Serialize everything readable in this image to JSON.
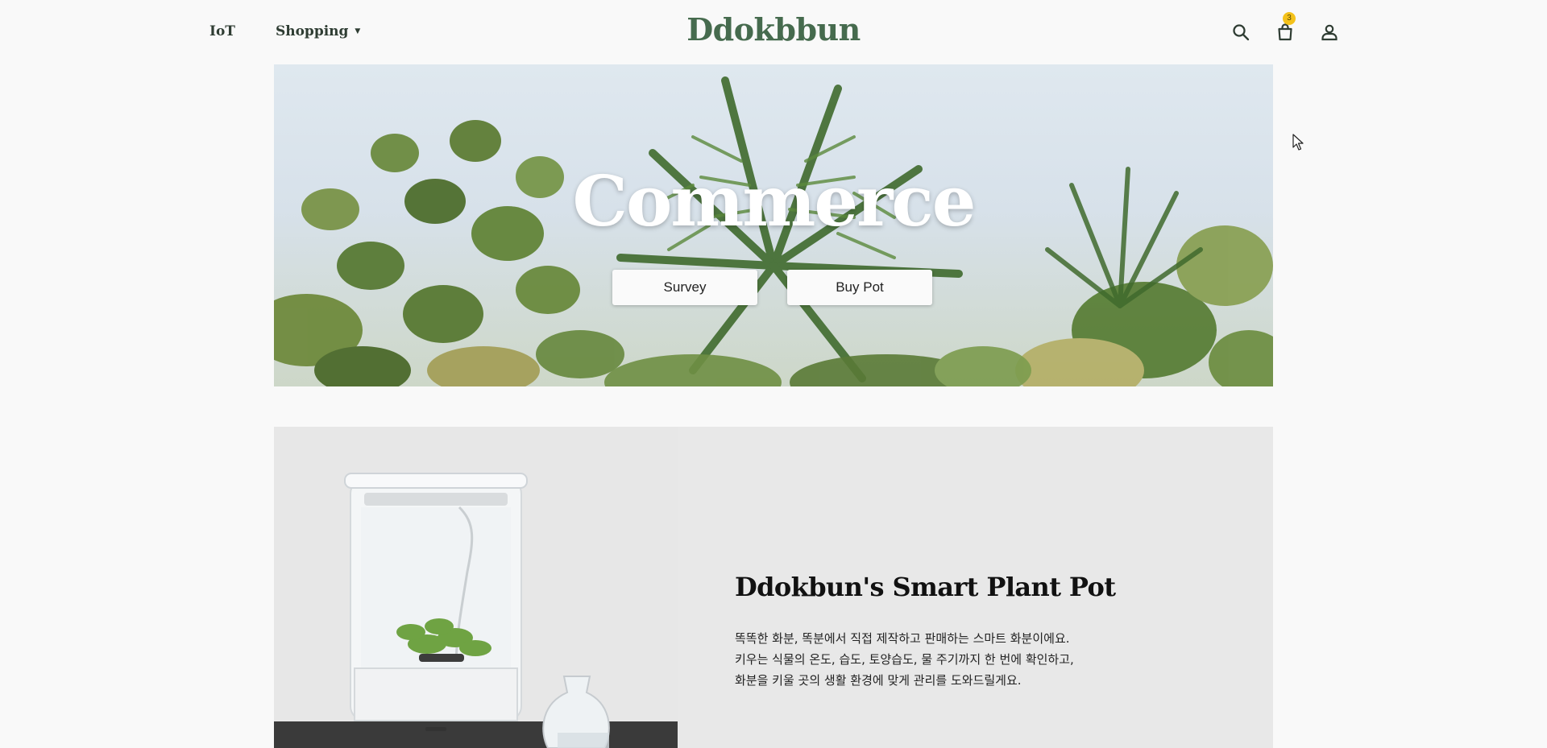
{
  "header": {
    "nav_left": {
      "iot": "IoT",
      "shopping": "Shopping"
    },
    "brand": "Ddokbbun",
    "cart_count": "3",
    "icons": [
      "search-icon",
      "cart-icon",
      "user-icon"
    ]
  },
  "hero": {
    "title": "Commerce",
    "buttons": {
      "survey": "Survey",
      "buy_pot": "Buy Pot"
    }
  },
  "product": {
    "title": "Ddokbun's Smart Plant Pot",
    "description": [
      "똑똑한 화분, 똑분에서 직접 제작하고 판매하는 스마트 화분이에요.",
      "키우는 식물의 온도, 습도, 토양습도, 물 주기까지 한 번에 확인하고,",
      "화분을 키울 곳의 생활 환경에 맞게 관리를 도와드릴게요."
    ]
  },
  "colors": {
    "brand": "#466b4e",
    "badge": "#f4c21b",
    "background": "#f9f9f9",
    "product_panel": "#e8e8e8"
  }
}
